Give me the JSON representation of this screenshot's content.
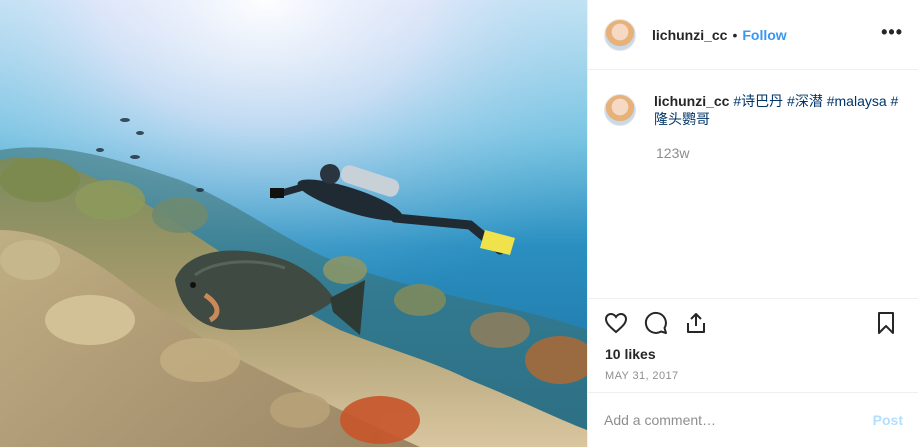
{
  "photo": {
    "alt": "Scuba diver swimming over coral reef with a large bumphead parrotfish"
  },
  "header": {
    "username": "lichunzi_cc",
    "separator": "•",
    "follow_label": "Follow",
    "more_label": "•••"
  },
  "caption": {
    "username": "lichunzi_cc",
    "hashtags": [
      "#诗巴丹",
      "#深潜",
      "#malaysa",
      "#隆头鹦哥"
    ],
    "age": "123w"
  },
  "actions": {
    "likes": "10 likes",
    "date": "MAY 31, 2017"
  },
  "comment": {
    "placeholder": "Add a comment…",
    "post_label": "Post"
  },
  "colors": {
    "link": "#003569",
    "follow": "#3897f0",
    "post_disabled": "#b2dffc",
    "muted": "#8e8e8e"
  }
}
